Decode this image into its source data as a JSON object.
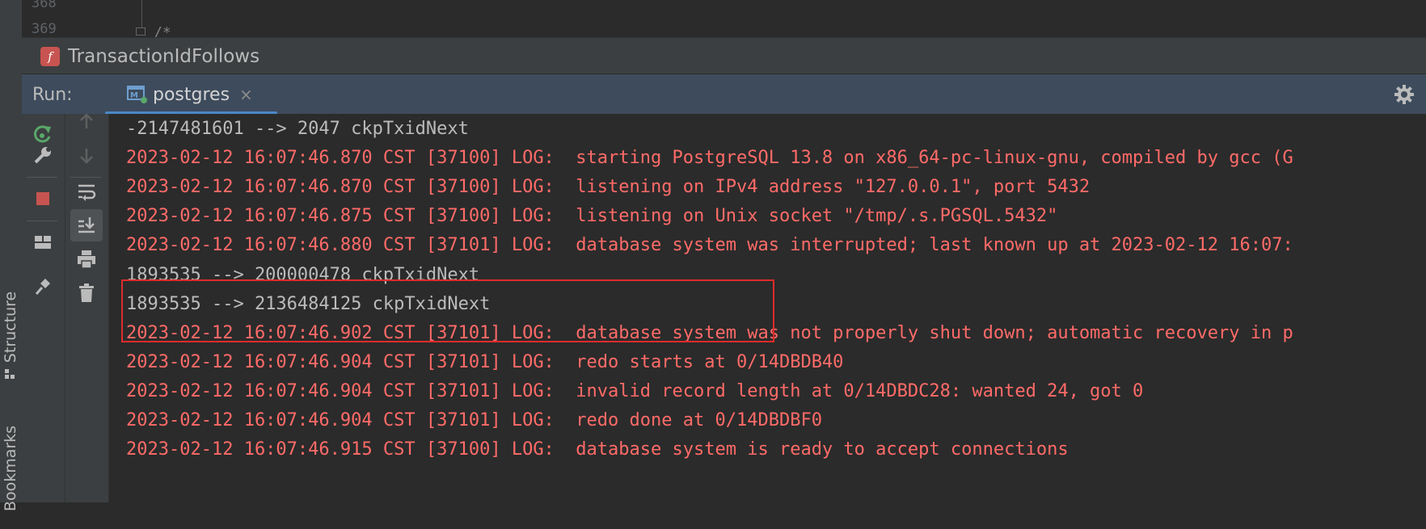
{
  "editor": {
    "gutter_numbers": [
      "368",
      "369"
    ],
    "code_fragment": "/*"
  },
  "breadcrumb": {
    "badge": "f",
    "label": "TransactionIdFollows"
  },
  "run_window": {
    "label": "Run:",
    "tab_title": "postgres",
    "tab_close": "×"
  },
  "toolbar_left": {
    "items": [
      "rerun-icon",
      "wrench-icon",
      "stop-icon",
      "layout-icon",
      "pin-icon"
    ]
  },
  "toolbar_right": {
    "items": [
      "arrow-up-icon",
      "arrow-down-icon",
      "soft-wrap-icon",
      "scroll-to-end-icon",
      "print-icon",
      "trash-icon"
    ]
  },
  "side_labels": {
    "structure": "Structure",
    "bookmarks": "Bookmarks"
  },
  "console": {
    "lines": [
      {
        "type": "plain",
        "text": "-2147481601 --> 2047 ckpTxidNext"
      },
      {
        "type": "log",
        "text": "2023-02-12 16:07:46.870 CST [37100] LOG:  starting PostgreSQL 13.8 on x86_64-pc-linux-gnu, compiled by gcc (G"
      },
      {
        "type": "log",
        "text": "2023-02-12 16:07:46.870 CST [37100] LOG:  listening on IPv4 address \"127.0.0.1\", port 5432"
      },
      {
        "type": "log",
        "text": "2023-02-12 16:07:46.875 CST [37100] LOG:  listening on Unix socket \"/tmp/.s.PGSQL.5432\""
      },
      {
        "type": "log",
        "text": "2023-02-12 16:07:46.880 CST [37101] LOG:  database system was interrupted; last known up at 2023-02-12 16:07:"
      },
      {
        "type": "plain",
        "text": "1893535 --> 200000478 ckpTxidNext"
      },
      {
        "type": "plain",
        "text": "1893535 --> 2136484125 ckpTxidNext"
      },
      {
        "type": "log",
        "text": "2023-02-12 16:07:46.902 CST [37101] LOG:  database system was not properly shut down; automatic recovery in p"
      },
      {
        "type": "log",
        "text": "2023-02-12 16:07:46.904 CST [37101] LOG:  redo starts at 0/14DBDB40"
      },
      {
        "type": "log",
        "text": "2023-02-12 16:07:46.904 CST [37101] LOG:  invalid record length at 0/14DBDC28: wanted 24, got 0"
      },
      {
        "type": "log",
        "text": "2023-02-12 16:07:46.904 CST [37101] LOG:  redo done at 0/14DBDBF0"
      },
      {
        "type": "log",
        "text": "2023-02-12 16:07:46.915 CST [37100] LOG:  database system is ready to accept connections"
      }
    ]
  },
  "colors": {
    "log_text": "#ff6b68",
    "plain_text": "#bbbbbb",
    "highlight_border": "#e02b2b",
    "tab_underline": "#4a88c7",
    "run_header_bg": "#3d4b5c"
  }
}
